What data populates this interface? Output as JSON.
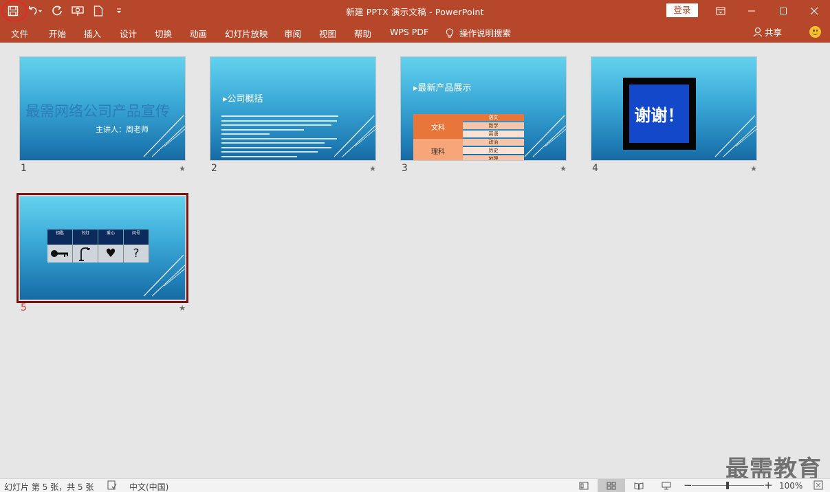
{
  "window": {
    "title": "新建 PPTX 演示文稿  -  PowerPoint",
    "login_label": "登录"
  },
  "qat": {
    "icons": [
      "save-icon",
      "undo-icon",
      "redo-icon",
      "present-icon",
      "new-doc-icon",
      "customize-icon"
    ]
  },
  "ribbon": {
    "tabs": [
      "文件",
      "开始",
      "插入",
      "设计",
      "切换",
      "动画",
      "幻灯片放映",
      "审阅",
      "视图",
      "帮助",
      "WPS PDF"
    ],
    "search_label": "操作说明搜索",
    "share_label": "共享"
  },
  "slides": [
    {
      "number": "1",
      "title": "最需网络公司产品宣传",
      "subtitle": "主讲人：周老师"
    },
    {
      "number": "2",
      "heading": "▸公司概括"
    },
    {
      "number": "3",
      "heading": "▸最新产品展示",
      "table": {
        "row1": "文科",
        "row2": "理科",
        "col_items": [
          "语文",
          "数学",
          "英语",
          "政治",
          "历史",
          "地理"
        ]
      }
    },
    {
      "number": "4",
      "text": "谢谢！"
    },
    {
      "number": "5",
      "headers": [
        "钥匙",
        "台灯",
        "爱心",
        "问号"
      ],
      "symbols": [
        "🔑",
        "⌠",
        "♥",
        "?"
      ]
    }
  ],
  "star_glyph": "★",
  "watermark": "最需教育",
  "status": {
    "slide_info": "幻灯片 第 5 张，共 5 张",
    "language": "中文(中国)",
    "zoom": "100%"
  },
  "colors": {
    "accent": "#b7472a",
    "selection": "#7b1212",
    "highlight_ring": "#e8252a"
  }
}
